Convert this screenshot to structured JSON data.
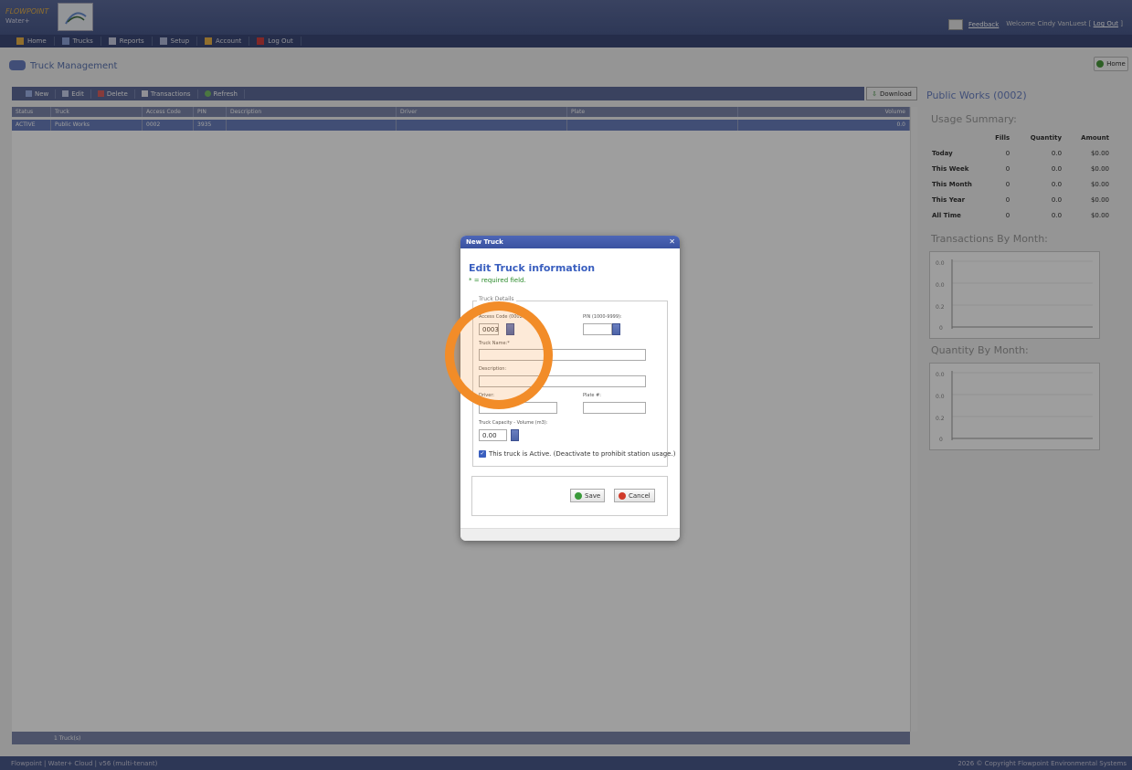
{
  "header": {
    "brand_line1": "FLOWPOINT",
    "brand_line2": "Water+",
    "feedback_label": "Feedback",
    "welcome_text": "Welcome Cindy VanLuest [",
    "logout_label": "Log Out",
    "welcome_close": "]"
  },
  "nav": {
    "items": [
      {
        "label": "Home",
        "icon": "home-icon"
      },
      {
        "label": "Trucks",
        "icon": "truck-icon"
      },
      {
        "label": "Reports",
        "icon": "reports-icon"
      },
      {
        "label": "Setup",
        "icon": "setup-icon"
      },
      {
        "label": "Account",
        "icon": "account-icon"
      },
      {
        "label": "Log Out",
        "icon": "logout-icon"
      }
    ]
  },
  "page": {
    "title": "Truck Management",
    "home_button": "Home"
  },
  "toolbar": {
    "new": "New",
    "edit": "Edit",
    "delete": "Delete",
    "transactions": "Transactions",
    "refresh": "Refresh",
    "download": "Download"
  },
  "grid": {
    "columns": [
      "Status",
      "Truck",
      "Access Code",
      "PIN",
      "Description",
      "Driver",
      "Plate",
      "Volume"
    ],
    "rows": [
      [
        "ACTIVE",
        "Public Works",
        "0002",
        "3935",
        "",
        "",
        "",
        "0.0"
      ]
    ],
    "footer": "1 Truck(s)"
  },
  "right_panel": {
    "title": "Public Works (0002)",
    "usage_title": "Usage Summary:",
    "usage_headers": [
      "Fills",
      "Quantity",
      "Amount"
    ],
    "usage_rows": [
      {
        "label": "Today",
        "fills": "0",
        "quantity": "0.0",
        "amount": "$0.00"
      },
      {
        "label": "This Week",
        "fills": "0",
        "quantity": "0.0",
        "amount": "$0.00"
      },
      {
        "label": "This Month",
        "fills": "0",
        "quantity": "0.0",
        "amount": "$0.00"
      },
      {
        "label": "This Year",
        "fills": "0",
        "quantity": "0.0",
        "amount": "$0.00"
      },
      {
        "label": "All Time",
        "fills": "0",
        "quantity": "0.0",
        "amount": "$0.00"
      }
    ],
    "transactions_chart_title": "Transactions By Month:",
    "quantity_chart_title": "Quantity By Month:",
    "chart_ticks": [
      "0.0",
      "0.0",
      "0.2",
      "0"
    ]
  },
  "dialog": {
    "header": "New Truck",
    "heading": "Edit Truck information",
    "required_note": "* = required field.",
    "legend": "Truck Details",
    "access_code_label": "Access Code (0002-99",
    "access_code_value": "0003",
    "pin_label": "PIN (1000-9999):",
    "pin_value": "",
    "truck_name_label": "Truck Name:*",
    "truck_name_value": "",
    "description_label": "Description:",
    "description_value": "",
    "driver_label": "Driver:",
    "driver_value": "",
    "plate_label": "Plate #:",
    "plate_value": "",
    "capacity_label": "Truck Capacity - Volume (m3):",
    "capacity_value": "0.00",
    "active_label": "This truck is Active. (Deactivate to prohibit station usage.)",
    "active_checked": true,
    "save_label": "Save",
    "cancel_label": "Cancel"
  },
  "footer": {
    "left": "Flowpoint  |  Water+ Cloud  |  v56 (multi-tenant)",
    "right": "2026 © Copyright Flowpoint Environmental Systems"
  },
  "colors": {
    "header": "#4a5a8c",
    "accent": "#3a5fbf",
    "highlight": "#f28c28",
    "selected_row": "#6a7fbd"
  }
}
